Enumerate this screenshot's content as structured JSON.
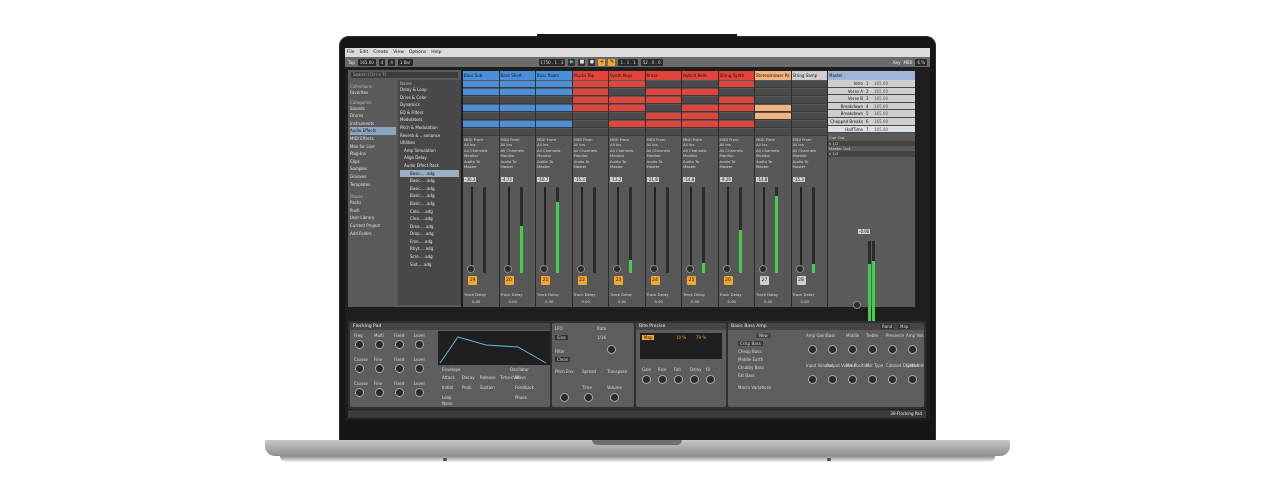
{
  "menu": [
    "File",
    "Edit",
    "Create",
    "View",
    "Options",
    "Help"
  ],
  "transport": {
    "tap": "Tap",
    "tempo": "165.00",
    "sig_num": "4",
    "sig_den": "4",
    "quant": "1 Bar",
    "position": "1750 . 1 . 3",
    "bars": "1 . 1 . 1",
    "loop": "52 . 0 . 0",
    "key": "Key",
    "midi": "MIDI",
    "cpu": "6 %"
  },
  "browser": {
    "search_placeholder": "Search (Ctrl + F)",
    "collections_label": "Collections",
    "favorites": "Favorites",
    "categories_label": "Categories",
    "categories": [
      "Sounds",
      "Drums",
      "Instruments",
      "Audio Effects",
      "MIDI Effects",
      "Max for Live",
      "Plug-Ins",
      "Clips",
      "Samples",
      "Grooves",
      "Templates"
    ],
    "places_label": "Places",
    "places": [
      "Packs",
      "Push",
      "User Library",
      "Current Project",
      "Add Folder..."
    ],
    "name_header": "Name",
    "items": [
      "Delay & Loop",
      "Drive & Color",
      "Dynamics",
      "EQ & Filters",
      "Modulators",
      "Pitch & Modulation",
      "Reverb & ...sonance",
      "Utilities",
      "Amp Simulation",
      "Align Delay",
      "Audio Effect Rack",
      "Basic.....adg",
      "Basic.....adg",
      "Basic.....adg",
      "Basic.....adg",
      "Basic.....adg",
      "Cabi.....adg",
      "Clea.....adg",
      "Drea.....adg",
      "Drop.....adg",
      "Fron.....adg",
      "Rhyt.....adg",
      "Scre.....adg",
      "Sixt.....adg"
    ]
  },
  "tracks": [
    {
      "name": "Bass Sub",
      "color": "#4a8fd9",
      "num": "19",
      "vol": "-30.3"
    },
    {
      "name": "Bass Short",
      "color": "#4a8fd9",
      "num": "20",
      "vol": "-4.73"
    },
    {
      "name": "Bass Roam",
      "color": "#4a8fd9",
      "num": "21",
      "vol": "-10.7"
    },
    {
      "name": "Plucks Top",
      "color": "#e0443a",
      "num": "22",
      "vol": "-15.3"
    },
    {
      "name": "Synth Keys",
      "color": "#e0443a",
      "num": "23",
      "vol": "-13.2"
    },
    {
      "name": "Brass",
      "color": "#e0443a",
      "num": "24",
      "vol": "-21.8"
    },
    {
      "name": "Hybrid Bells",
      "color": "#e0443a",
      "num": "25",
      "vol": "-14.8"
    },
    {
      "name": "String Synth",
      "color": "#e0443a",
      "num": "26",
      "vol": "-9.29"
    },
    {
      "name": "Stereoshower Pa",
      "color": "#f3b37a",
      "num": "27",
      "vol": "-14.8"
    },
    {
      "name": "String Samp",
      "color": "#cfcfcf",
      "num": "28",
      "vol": "-15.3"
    }
  ],
  "track_io": {
    "midi_from": "MIDI From",
    "all_ins": "All Ins",
    "all_channels": "All Channels",
    "monitor": "Monitor",
    "in": "In",
    "auto": "Auto",
    "off": "Off",
    "audio_to": "Audio To",
    "master": "Master",
    "send": "Track Delay",
    "send_val": "0.00"
  },
  "master_track": {
    "name": "Master",
    "cue_out": "Cue Out",
    "cue_val": "ii 1/2",
    "master_out": "Master Out",
    "master_val": "ii 1/2",
    "vol": "-0.90",
    "scenes": [
      {
        "name": "Intro",
        "num": "1",
        "tempo": "165.00"
      },
      {
        "name": "Verse A",
        "num": "2",
        "tempo": "165.00"
      },
      {
        "name": "Verse B",
        "num": "3",
        "tempo": "165.00"
      },
      {
        "name": "Breakdown",
        "num": "4",
        "tempo": "165.00"
      },
      {
        "name": "Breakdown",
        "num": "5",
        "tempo": "165.00"
      },
      {
        "name": "Chopped Breaks",
        "num": "6",
        "tempo": "165.00"
      },
      {
        "name": "HalfTime",
        "num": "7",
        "tempo": "165.00"
      }
    ]
  },
  "devices": {
    "drift": {
      "title": "Flocking Pad",
      "labels": [
        "Freq",
        "Multi",
        "Fixed",
        "Level",
        "Coarse",
        "Fine",
        "Fixed",
        "Level",
        "Coarse",
        "Fine",
        "Fixed",
        "Level"
      ],
      "env": "Envelope",
      "attack": "Attack",
      "decay": "Decay",
      "release": "Release",
      "time_vel": "Time<Vel",
      "initial": "Initial",
      "peak": "Peak",
      "sustain": "Sustain",
      "vel": "Vel",
      "loop": "Loop",
      "none": "None",
      "osc": "Oscillator",
      "wave": "Wave",
      "feedback": "Feedback",
      "repeat": "Repeat",
      "rate": "Rate",
      "phase": "Phase",
      "off": "Off"
    },
    "lfo": {
      "label": "LFO",
      "shape": "Sine",
      "rate": "Rate",
      "rate_val": "1/16",
      "filter": "Filter",
      "pitch_env": "Pitch Env",
      "spread": "Spread",
      "transpose": "Transpose",
      "time": "Time",
      "volume": "Volume",
      "clean": "Clean"
    },
    "vinyl": {
      "title": "Bite Precise",
      "map": "Map",
      "vals": [
        "10 %",
        "79 %"
      ],
      "labels": [
        "Gain",
        "Rise",
        "Fall",
        "Delay",
        "Fil"
      ]
    },
    "amp": {
      "title": "Basic Bass Amp",
      "rand": "Rand",
      "map": "Map",
      "presets": [
        "Crisp Bass",
        "Cheap Bass",
        "Middle Earth",
        "Chubby Bass",
        "Fat Bass"
      ],
      "variations": "Macro Variations",
      "new": "New",
      "knobs": [
        "Amp Gain",
        "Bass",
        "Middle",
        "Treble",
        "Presence",
        "Amp Volume",
        "Input Volume",
        "Output Volume",
        "Mic Position",
        "Mic Type",
        "Cabinet Dry/Wet",
        "Gate Intensity"
      ]
    }
  },
  "status": {
    "track_name": "30-Flocking Pad"
  }
}
